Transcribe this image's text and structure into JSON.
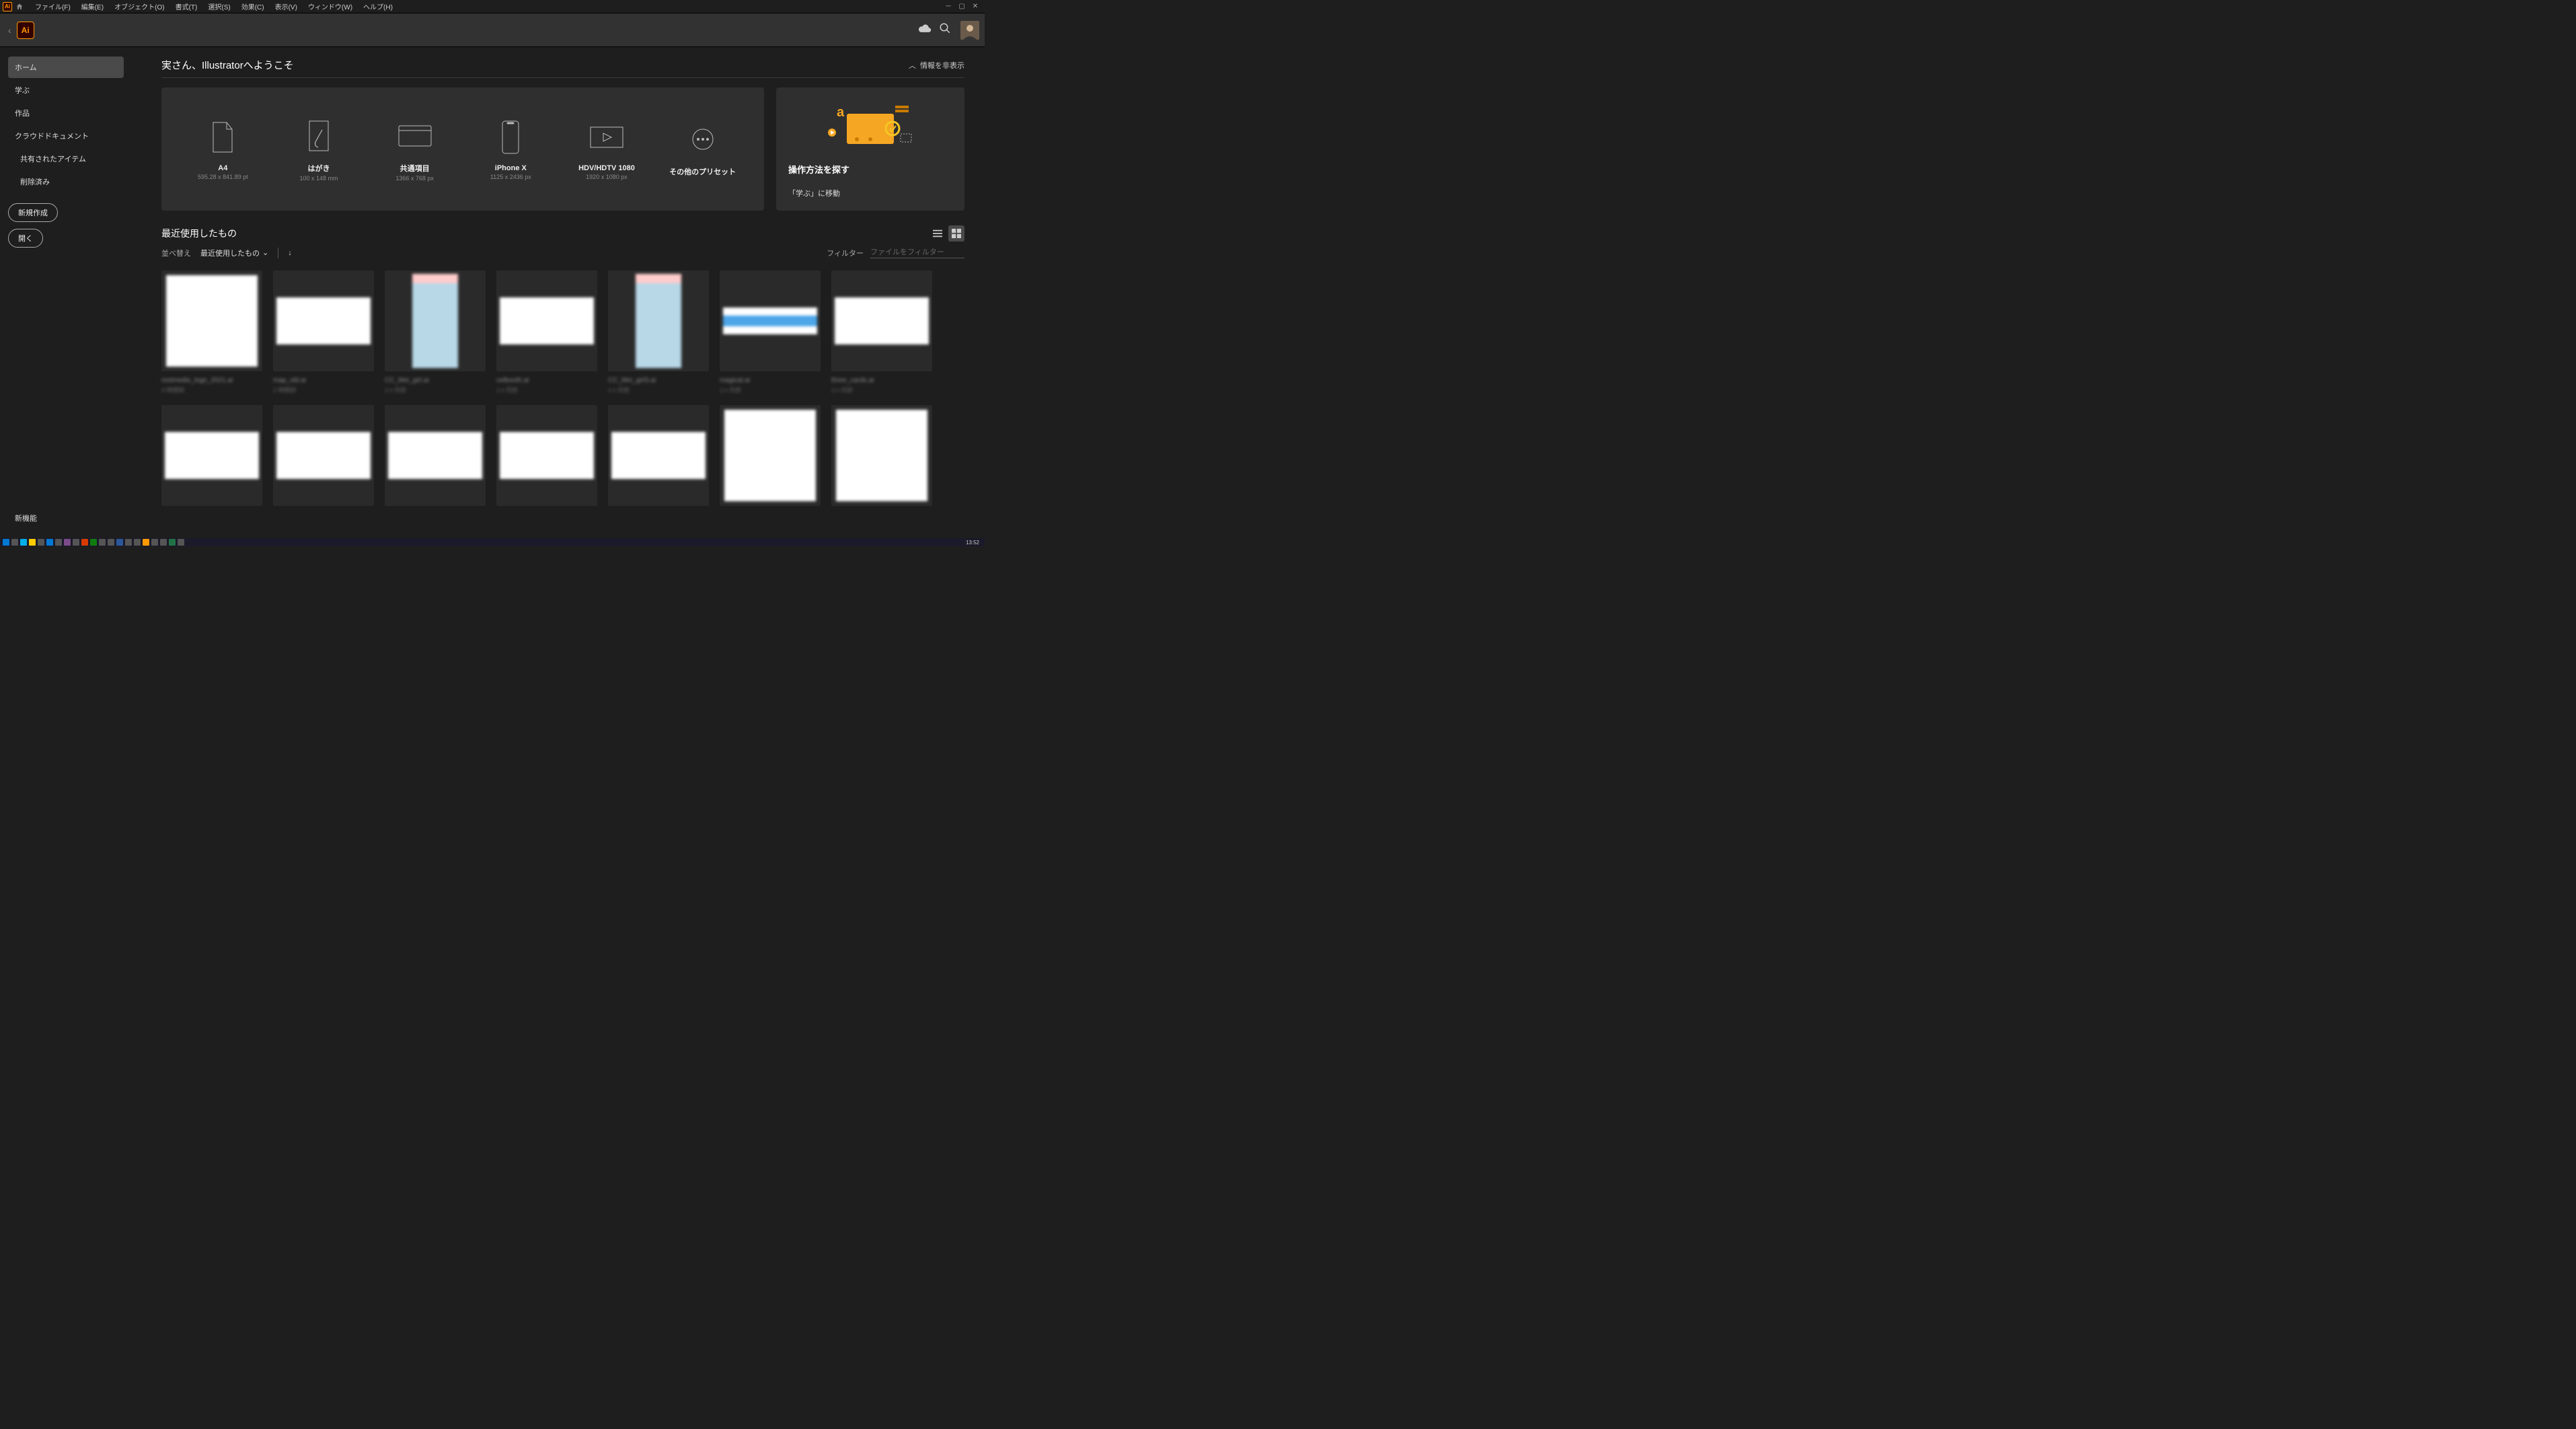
{
  "menubar": {
    "items": [
      "ファイル(F)",
      "編集(E)",
      "オブジェクト(O)",
      "書式(T)",
      "選択(S)",
      "効果(C)",
      "表示(V)",
      "ウィンドウ(W)",
      "ヘルプ(H)"
    ]
  },
  "sidebar": {
    "items": [
      {
        "label": "ホーム",
        "active": true
      },
      {
        "label": "学ぶ"
      },
      {
        "label": "作品"
      },
      {
        "label": "クラウドドキュメント"
      },
      {
        "label": "共有されたアイテム",
        "sub": true
      },
      {
        "label": "削除済み",
        "sub": true
      }
    ],
    "new_btn": "新規作成",
    "open_btn": "開く",
    "whatsnew": "新機能"
  },
  "welcome": {
    "title": "実さん、Illustratorへようこそ",
    "hideinfo": "情報を非表示"
  },
  "presets": [
    {
      "label": "A4",
      "dim": "595.28 x 841.89 pt",
      "icon": "doc"
    },
    {
      "label": "はがき",
      "dim": "100 x 148 mm",
      "icon": "brush"
    },
    {
      "label": "共通項目",
      "dim": "1366 x 768 px",
      "icon": "browser"
    },
    {
      "label": "iPhone X",
      "dim": "1125 x 2436 px",
      "icon": "phone"
    },
    {
      "label": "HDV/HDTV 1080",
      "dim": "1920 x 1080 px",
      "icon": "video"
    },
    {
      "label": "その他のプリセット",
      "dim": "",
      "icon": "more"
    }
  ],
  "learn": {
    "title": "操作方法を探す",
    "link": "「学ぶ」に移動"
  },
  "recent": {
    "title": "最近使用したもの",
    "sort_label": "並べ替え",
    "sort_value": "最近使用したもの",
    "filter_label": "フィルター",
    "filter_placeholder": "ファイルをフィルター",
    "files": [
      {
        "name": "restmedix_logo_2021.ai",
        "time": "4 時間前",
        "shape": "square"
      },
      {
        "name": "map_old.ai",
        "time": "2 時間前",
        "shape": "wide"
      },
      {
        "name": "CC_Mei_girl.ai",
        "time": "1ヶ月前",
        "shape": "char"
      },
      {
        "name": "celbooth.ai",
        "time": "1ヶ月前",
        "shape": "wide"
      },
      {
        "name": "CC_Mei_girl3.ai",
        "time": "1ヶ月前",
        "shape": "char"
      },
      {
        "name": "magical.ai",
        "time": "1ヶ月前",
        "shape": "banner"
      },
      {
        "name": "three_cards.ai",
        "time": "1ヶ月前",
        "shape": "wide"
      },
      {
        "name": "",
        "time": "",
        "shape": "wide"
      },
      {
        "name": "",
        "time": "",
        "shape": "wide"
      },
      {
        "name": "",
        "time": "",
        "shape": "wide"
      },
      {
        "name": "",
        "time": "",
        "shape": "wide"
      },
      {
        "name": "",
        "time": "",
        "shape": "wide"
      },
      {
        "name": "",
        "time": "",
        "shape": "square"
      },
      {
        "name": "",
        "time": "",
        "shape": "square"
      }
    ]
  },
  "taskbar": {
    "clock": "13:52"
  }
}
